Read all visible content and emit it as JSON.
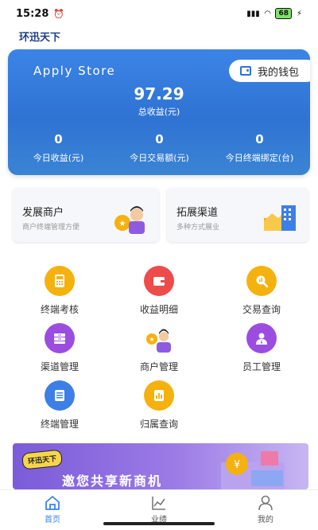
{
  "status": {
    "time": "15:28",
    "battery": "68"
  },
  "app_title": "环迅天下",
  "hero": {
    "store_name": "Apply Store",
    "wallet_label": "我的钱包",
    "total_value": "97.29",
    "total_label": "总收益(元)",
    "stats": [
      {
        "value": "0",
        "label": "今日收益(元)"
      },
      {
        "value": "0",
        "label": "今日交易额(元)"
      },
      {
        "value": "0",
        "label": "今日终端绑定(台)"
      }
    ]
  },
  "promos": [
    {
      "title": "发展商户",
      "subtitle": "商户终端管理方便"
    },
    {
      "title": "拓展渠道",
      "subtitle": "多种方式展业"
    }
  ],
  "menu": [
    {
      "label": "终端考核",
      "icon": "terminal-assess-icon",
      "color": "#f5b10e"
    },
    {
      "label": "收益明细",
      "icon": "wallet-icon",
      "color": "#ee4b4b"
    },
    {
      "label": "交易查询",
      "icon": "search-chart-icon",
      "color": "#f5b10e"
    },
    {
      "label": "渠道管理",
      "icon": "channel-icon",
      "color": "#9b4de0"
    },
    {
      "label": "商户管理",
      "icon": "merchant-icon",
      "color": "#f5b10e"
    },
    {
      "label": "员工管理",
      "icon": "staff-icon",
      "color": "#9b4de0"
    },
    {
      "label": "终端管理",
      "icon": "document-icon",
      "color": "#3d7fe6"
    },
    {
      "label": "归属查询",
      "icon": "chart-doc-icon",
      "color": "#f5b10e"
    }
  ],
  "banner": {
    "badge": "环迅天下",
    "slogan": "邀您共享新商机"
  },
  "tabs": [
    {
      "label": "首页",
      "active": true
    },
    {
      "label": "业绩",
      "active": false
    },
    {
      "label": "我的",
      "active": false
    }
  ],
  "colors": {
    "primary": "#3b84e6",
    "accent_yellow": "#f5b10e",
    "accent_purple": "#9b4de0",
    "accent_red": "#ee4b4b"
  }
}
